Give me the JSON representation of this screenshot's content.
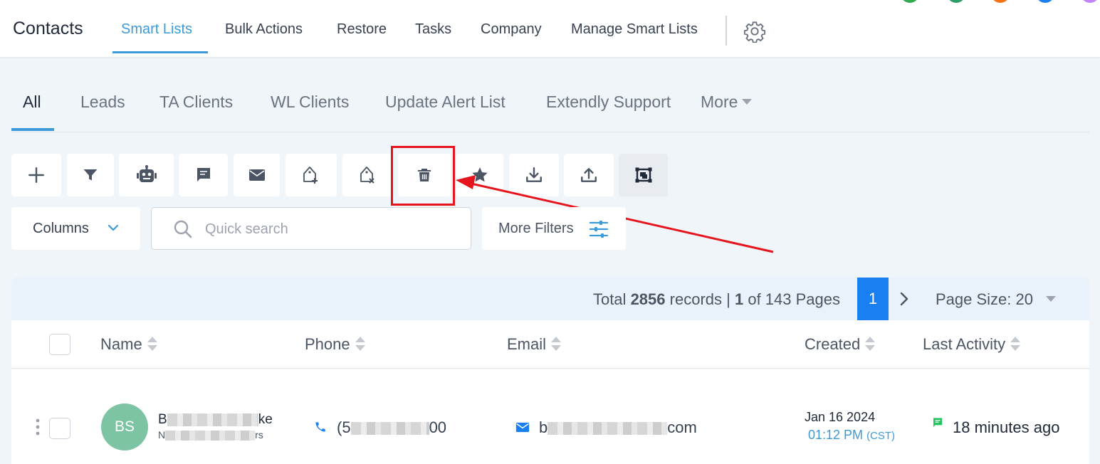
{
  "header": {
    "title": "Contacts",
    "nav": [
      {
        "label": "Smart Lists",
        "active": true
      },
      {
        "label": "Bulk Actions"
      },
      {
        "label": "Restore"
      },
      {
        "label": "Tasks"
      },
      {
        "label": "Company"
      },
      {
        "label": "Manage Smart Lists"
      }
    ],
    "settings_icon": "gear-icon",
    "accent_color": "#3b9ad9"
  },
  "smart_lists": {
    "tabs": [
      {
        "label": "All",
        "active": true
      },
      {
        "label": "Leads"
      },
      {
        "label": "TA Clients"
      },
      {
        "label": "WL Clients"
      },
      {
        "label": "Update Alert List"
      },
      {
        "label": "Extendly Support"
      }
    ],
    "more_label": "More"
  },
  "toolbar": {
    "buttons": [
      {
        "name": "add-icon"
      },
      {
        "name": "filter-icon"
      },
      {
        "name": "robot-icon"
      },
      {
        "name": "message-icon"
      },
      {
        "name": "email-icon"
      },
      {
        "name": "add-tag-icon"
      },
      {
        "name": "remove-tag-icon"
      },
      {
        "name": "trash-icon",
        "highlighted": true
      },
      {
        "name": "star-icon"
      },
      {
        "name": "import-icon"
      },
      {
        "name": "export-icon"
      },
      {
        "name": "merge-icon"
      }
    ],
    "highlight_color": "#e6141d"
  },
  "filters": {
    "columns_label": "Columns",
    "search_placeholder": "Quick search",
    "search_value": "",
    "more_filters_label": "More Filters"
  },
  "pager": {
    "total_prefix": "Total",
    "total_records": "2856",
    "records_word": "records |",
    "current_page": "1",
    "of_pages": "of 143 Pages",
    "page_button": "1",
    "page_size_label": "Page Size: 20"
  },
  "table": {
    "columns": [
      "Name",
      "Phone",
      "Email",
      "Created",
      "Last Activity"
    ],
    "rows": [
      {
        "initials": "BS",
        "avatar_color": "#7cc4a2",
        "name_start": "B",
        "name_end": "ke",
        "sub_start": "N",
        "sub_end": "rs",
        "phone_start": "(5",
        "phone_end": "00",
        "email_start": "b",
        "email_end": "com",
        "created_date": "Jan 16 2024",
        "created_time": "01:12 PM",
        "created_tz": "(CST)",
        "last_activity": "18 minutes ago"
      }
    ]
  }
}
